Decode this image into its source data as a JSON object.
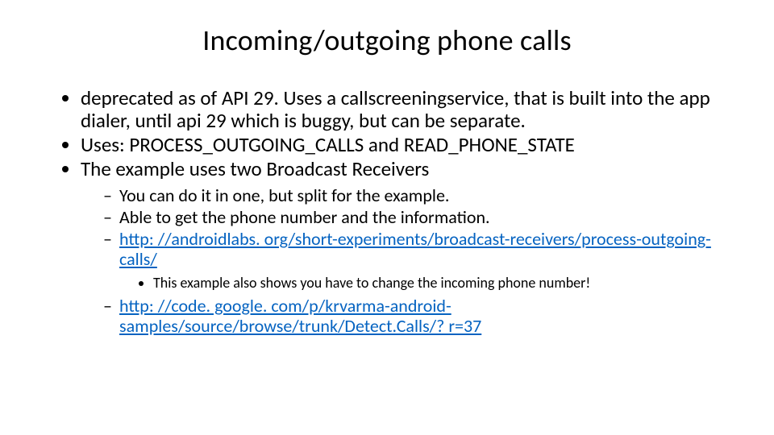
{
  "title": "Incoming/outgoing phone calls",
  "b1": "deprecated as of API 29.  Uses a callscreeningservice, that is built into the app dialer, until api 29 which is buggy, but can be separate.",
  "b2": "Uses: PROCESS_OUTGOING_CALLS and READ_PHONE_STATE",
  "b3": "The example uses two Broadcast Receivers",
  "s1": "You can do it in one, but split for the example.",
  "s2": "Able to get the phone number and the information.",
  "s3_link": "http: //androidlabs. org/short-experiments/broadcast-receivers/process-outgoing-calls/",
  "s3_sub": "This example also shows you have to change the incoming phone number!",
  "s4_link": "http: //code. google. com/p/krvarma-android-samples/source/browse/trunk/Detect.Calls/? r=37"
}
